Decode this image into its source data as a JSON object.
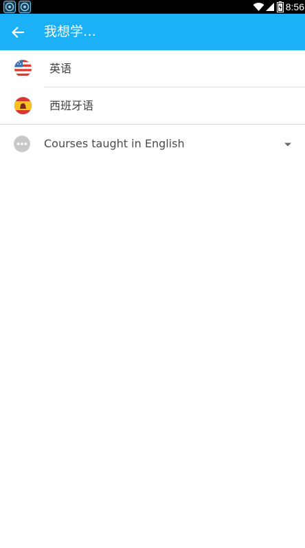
{
  "app_bar": {
    "title": "我想学…",
    "background_color": "#1cb0f6"
  },
  "status_bar": {
    "time": "8:56",
    "icons": [
      "app-icon",
      "app-icon",
      "wifi-icon",
      "signal-icon",
      "battery-icon"
    ]
  },
  "languages": [
    {
      "label": "英语",
      "icon": "us-flag-icon"
    },
    {
      "label": "西班牙语",
      "icon": "spain-flag-icon"
    }
  ],
  "courses": {
    "label": "Courses taught in English",
    "icon": "more-icon"
  }
}
